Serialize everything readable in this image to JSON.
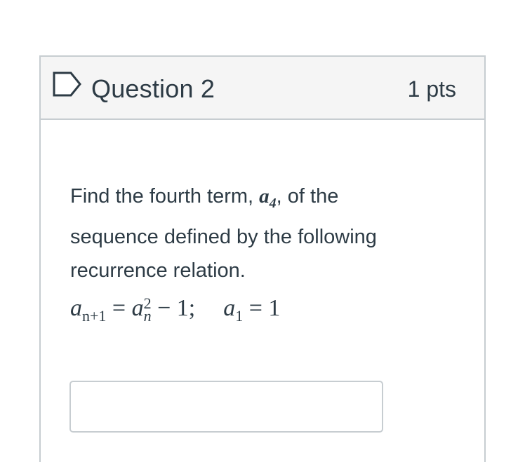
{
  "question": {
    "title": "Question 2",
    "points": "1 pts",
    "text_before": "Find the fourth term, ",
    "term_var": "a",
    "term_sub": "4",
    "text_after": ", of the sequence defined by the following recurrence relation.",
    "equation": {
      "lhs_var": "a",
      "lhs_sub": "n+1",
      "eq1": " = ",
      "rhs_var": "a",
      "rhs_sup": "2",
      "rhs_sub": "n",
      "rhs_rest": " − 1;",
      "init_var": "a",
      "init_sub": "1",
      "init_rest": " = 1"
    },
    "answer": {
      "value": "",
      "placeholder": ""
    }
  },
  "icons": {
    "flag": "flag-outline-icon"
  },
  "colors": {
    "text": "#2d3b45",
    "header_bg": "#f5f5f5",
    "border": "#c7cdd1"
  }
}
